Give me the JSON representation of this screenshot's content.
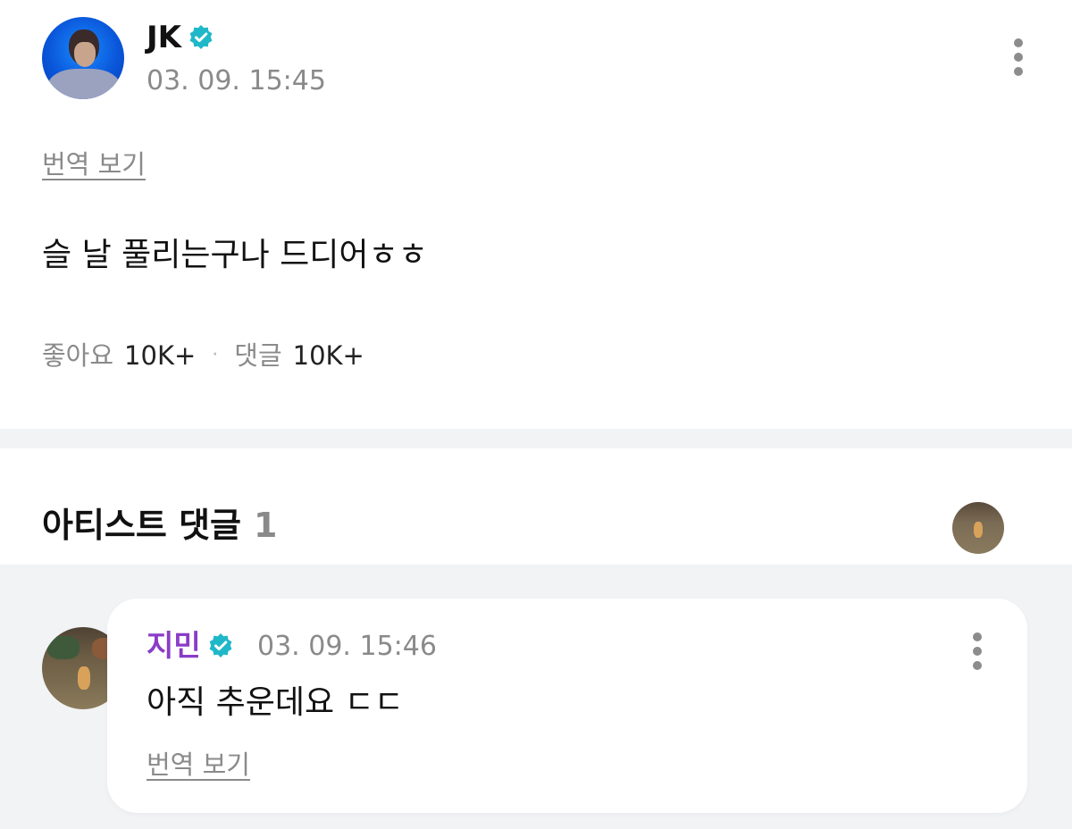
{
  "post": {
    "author": "JK",
    "verified": true,
    "timestamp": "03. 09. 15:45",
    "translate_label": "번역 보기",
    "body": "슬 날 풀리는구나 드디어ㅎㅎ",
    "likes_label": "좋아요",
    "likes_count": "10K+",
    "stat_separator": "·",
    "comments_label": "댓글",
    "comments_count": "10K+"
  },
  "artist_comments": {
    "title": "아티스트 댓글",
    "count": "1",
    "comments": [
      {
        "author": "지민",
        "verified": true,
        "timestamp": "03. 09. 15:46",
        "text": "아직 추운데요 ㄷㄷ",
        "translate_label": "번역 보기"
      }
    ]
  },
  "colors": {
    "verified_badge": "#1fb8c9",
    "artist_name": "#8a3cc8",
    "muted_text": "#8a8a8a",
    "section_background": "#f2f3f5"
  },
  "icons": {
    "verified": "verified-badge-icon",
    "more": "more-vertical-icon"
  }
}
